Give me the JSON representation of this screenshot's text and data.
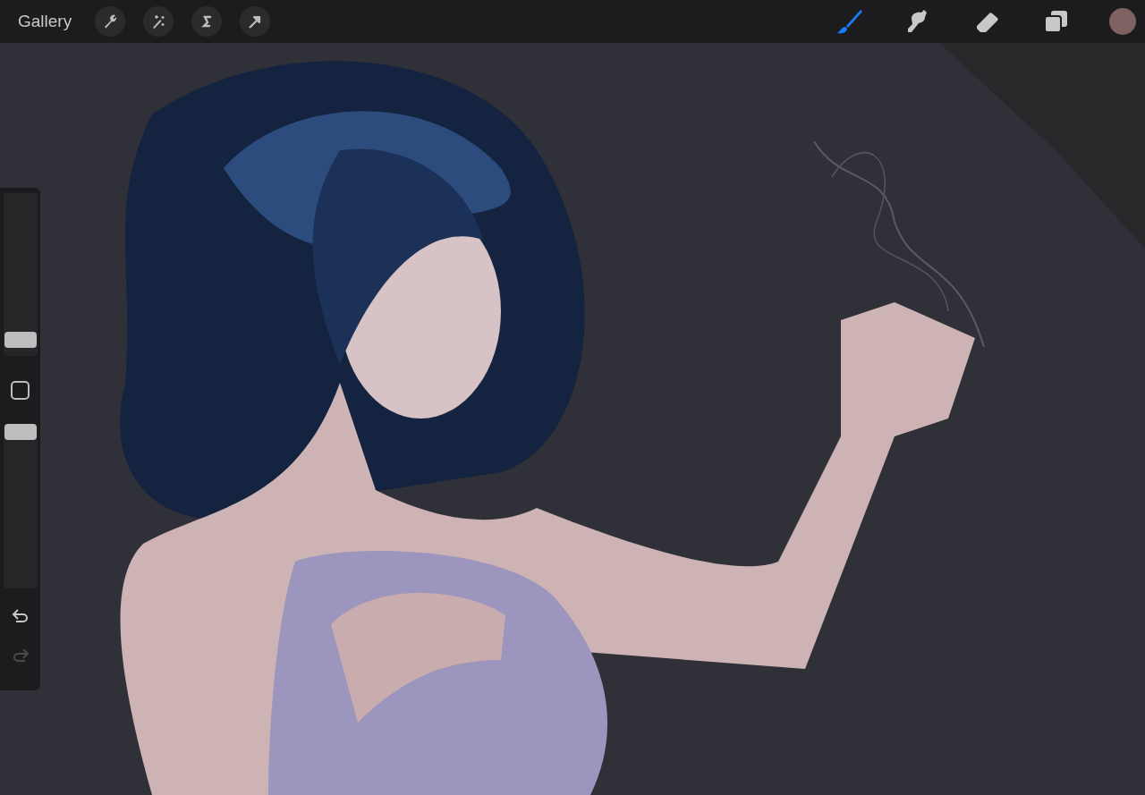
{
  "toolbar": {
    "gallery": "Gallery",
    "actions": [
      {
        "kind": "wrench"
      },
      {
        "kind": "wand"
      },
      {
        "kind": "selection"
      },
      {
        "kind": "transform"
      }
    ],
    "tools": [
      {
        "kind": "brush",
        "selected": true
      },
      {
        "kind": "smudge",
        "selected": false
      },
      {
        "kind": "eraser",
        "selected": false
      },
      {
        "kind": "layers",
        "selected": false
      }
    ],
    "color_swatch": {
      "color": "#7e6262"
    }
  },
  "sidebar": {
    "brush_size": {
      "level": 0.05
    },
    "opacity": {
      "level": 1
    },
    "undo": {
      "disabled": false
    },
    "redo": {
      "disabled": true
    }
  }
}
